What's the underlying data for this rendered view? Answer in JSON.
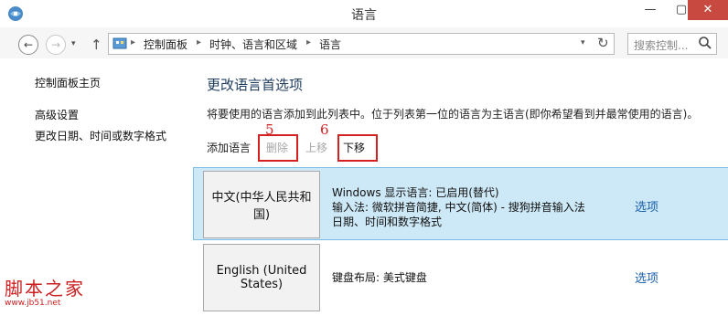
{
  "window": {
    "title": "语言",
    "min": "—",
    "max": "▢",
    "close": "✕"
  },
  "nav": {
    "back": "←",
    "forward": "→",
    "dropdown": "▾",
    "up": "↑"
  },
  "address": {
    "crumbs": [
      "控制面板",
      "时钟、语言和区域",
      "语言"
    ],
    "separator": "▸",
    "dropdown": "▾",
    "refresh": "↻"
  },
  "search": {
    "placeholder": "搜索控制..."
  },
  "sidebar": {
    "home": "控制面板主页",
    "advanced": "高级设置",
    "datetime": "更改日期、时间或数字格式"
  },
  "main": {
    "title": "更改语言首选项",
    "description": "将要使用的语言添加到此列表中。位于列表第一位的语言为主语言(即你希望看到并最常使用的语言)。"
  },
  "toolbar": {
    "add": "添加语言",
    "remove": "删除",
    "move_up": "上移",
    "move_down": "下移"
  },
  "annotations": {
    "five": "5",
    "six": "6"
  },
  "languages": [
    {
      "name": "中文(中华人民共和国)",
      "line1": "Windows 显示语言: 已启用(替代)",
      "line2": "输入法: 微软拼音简捷, 中文(简体) - 搜狗拼音输入法",
      "line3": "日期、时间和数字格式",
      "options": "选项"
    },
    {
      "name": "English (United States)",
      "line1": "键盘布局: 美式键盘",
      "options": "选项"
    }
  ],
  "watermark": {
    "text": "脚本之家",
    "url": "www.jb51.net"
  },
  "colors": {
    "close": "#c7493f",
    "selected_row": "#cde8f6",
    "annotation": "#d32020",
    "link": "#1a5fa8"
  }
}
